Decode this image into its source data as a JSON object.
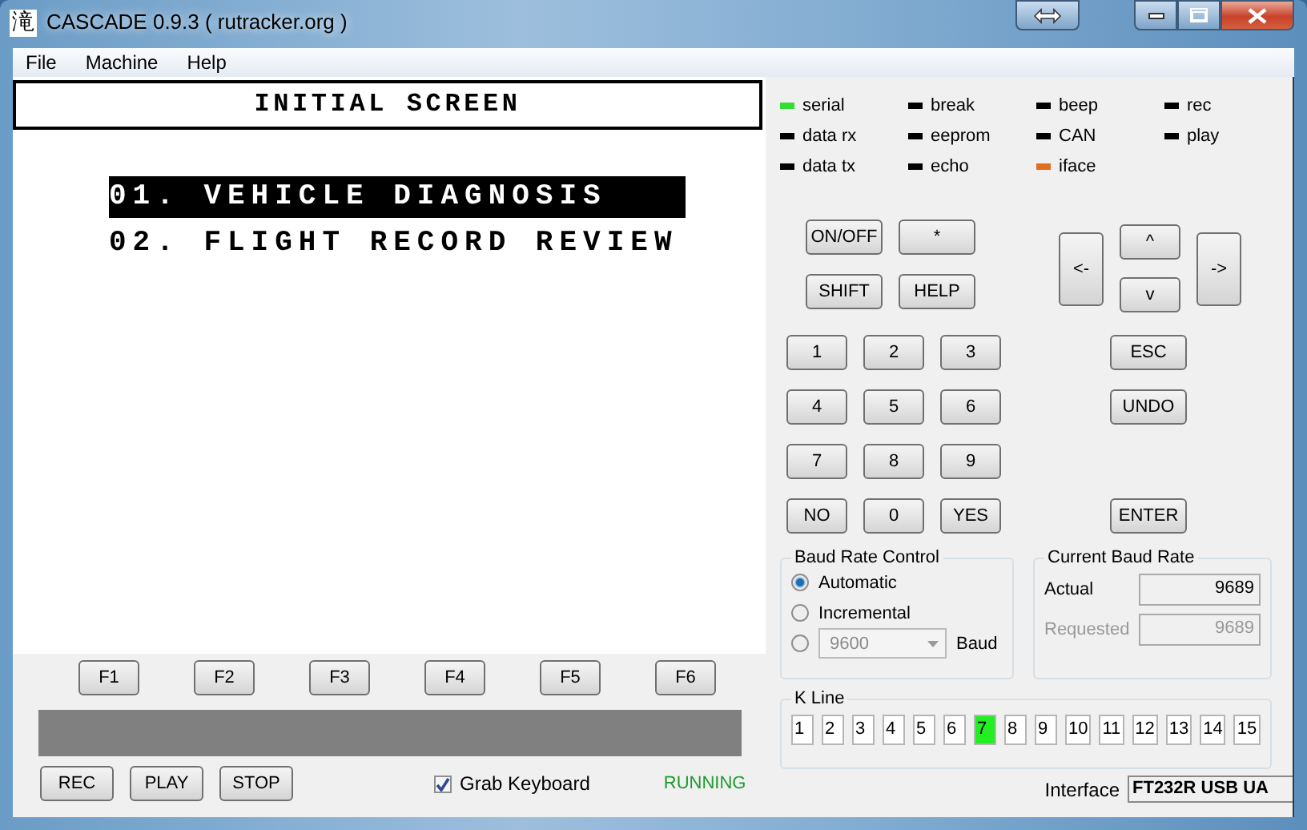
{
  "window": {
    "icon_glyph": "滝",
    "title": "CASCADE 0.9.3 ( rutracker.org )"
  },
  "menu": [
    "File",
    "Machine",
    "Help"
  ],
  "screen": {
    "title": "INITIAL SCREEN",
    "items": [
      {
        "label": "01. VEHICLE DIAGNOSIS",
        "selected": true
      },
      {
        "label": "02. FLIGHT RECORD REVIEW",
        "selected": false
      }
    ]
  },
  "function_keys": [
    "F1",
    "F2",
    "F3",
    "F4",
    "F5",
    "F6"
  ],
  "transport_buttons": [
    "REC",
    "PLAY",
    "STOP"
  ],
  "grab_keyboard": {
    "label": "Grab Keyboard",
    "checked": true
  },
  "run_state": "RUNNING",
  "indicators": [
    {
      "label": "serial",
      "color": "#33dd33"
    },
    {
      "label": "break",
      "color": "#000000"
    },
    {
      "label": "beep",
      "color": "#000000"
    },
    {
      "label": "rec",
      "color": "#000000"
    },
    {
      "label": "data rx",
      "color": "#000000"
    },
    {
      "label": "eeprom",
      "color": "#000000"
    },
    {
      "label": "CAN",
      "color": "#000000"
    },
    {
      "label": "play",
      "color": "#000000"
    },
    {
      "label": "data tx",
      "color": "#000000"
    },
    {
      "label": "echo",
      "color": "#000000"
    },
    {
      "label": "iface",
      "color": "#e07020"
    }
  ],
  "control_keys": [
    "ON/OFF",
    "*",
    "SHIFT",
    "HELP"
  ],
  "arrow_keys": {
    "left": "<-",
    "up": "^",
    "down": "v",
    "right": "->"
  },
  "keypad": [
    "1",
    "2",
    "3",
    "4",
    "5",
    "6",
    "7",
    "8",
    "9",
    "NO",
    "0",
    "YES"
  ],
  "side_keys": [
    "ESC",
    "UNDO",
    "ENTER"
  ],
  "baud_rate_control": {
    "title": "Baud Rate Control",
    "options": [
      {
        "label": "Automatic",
        "selected": true
      },
      {
        "label": "Incremental",
        "selected": false
      },
      {
        "kind": "dropdown",
        "value": "9600",
        "disabled": true,
        "unit": "Baud",
        "selected": false
      }
    ]
  },
  "current_baud_rate": {
    "title": "Current Baud Rate",
    "actual_label": "Actual",
    "actual": "9689",
    "requested_label": "Requested",
    "requested": "9689",
    "requested_disabled": true
  },
  "k_line": {
    "title": "K Line",
    "lines": [
      {
        "label": "1",
        "selected": false
      },
      {
        "label": "2",
        "selected": false
      },
      {
        "label": "3",
        "selected": false
      },
      {
        "label": "4",
        "selected": false
      },
      {
        "label": "5",
        "selected": false
      },
      {
        "label": "6",
        "selected": false
      },
      {
        "label": "7",
        "selected": true
      },
      {
        "label": "8",
        "selected": false
      },
      {
        "label": "9",
        "selected": false
      },
      {
        "label": "10",
        "selected": false
      },
      {
        "label": "11",
        "selected": false
      },
      {
        "label": "12",
        "selected": false
      },
      {
        "label": "13",
        "selected": false
      },
      {
        "label": "14",
        "selected": false
      },
      {
        "label": "15",
        "selected": false
      }
    ]
  },
  "interface": {
    "label": "Interface",
    "value": "FT232R USB UA"
  }
}
